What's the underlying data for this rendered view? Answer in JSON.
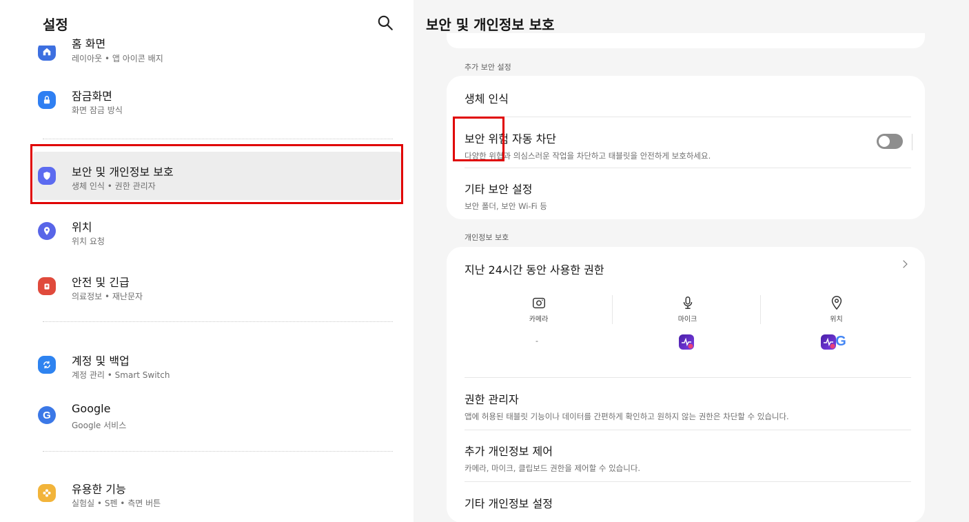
{
  "left": {
    "title": "설정",
    "partial_item_title": "홈 화면",
    "items": [
      {
        "icon": "home-icon",
        "color": "#3d6fe0",
        "title": "",
        "subtitle": "레이아웃 • 앱 아이콘 배지"
      },
      {
        "icon": "lock-icon",
        "color": "#2f7ff2",
        "title": "잠금화면",
        "subtitle": "화면 잠금 방식"
      },
      {
        "icon": "shield-icon",
        "color": "#5c6bf0",
        "title": "보안 및 개인정보 보호",
        "subtitle": "생체 인식 • 권한 관리자"
      },
      {
        "icon": "location-pin-icon",
        "color": "#5865e8",
        "title": "위치",
        "subtitle": "위치 요청"
      },
      {
        "icon": "emergency-icon",
        "color": "#e04a3c",
        "title": "안전 및 긴급",
        "subtitle": "의료정보 • 재난문자"
      },
      {
        "icon": "sync-icon",
        "color": "#2e83f0",
        "title": "계정 및 백업",
        "subtitle": "계정 관리 • Smart Switch"
      },
      {
        "icon": "google-g-icon",
        "color": "#3b78e7",
        "title": "Google",
        "subtitle": "Google 서비스"
      },
      {
        "icon": "flower-icon",
        "color": "#f2b43a",
        "title": "유용한 기능",
        "subtitle": "실험실 • S펜 • 측면 버튼"
      }
    ]
  },
  "right": {
    "title": "보안 및 개인정보 보호",
    "section_security": "추가 보안 설정",
    "biometrics": {
      "title": "생체 인식"
    },
    "auto_blocker": {
      "title": "보안 위험 자동 차단",
      "subtitle": "다양한 위협과 의심스러운 작업을 차단하고 태블릿을 안전하게 보호하세요.",
      "toggle_on": false
    },
    "other_security": {
      "title": "기타 보안 설정",
      "subtitle": "보안 폴더, 보안 Wi-Fi 등"
    },
    "section_privacy": "개인정보 보호",
    "perm_usage": {
      "title": "지난 24시간 동안 사용한 권한",
      "columns": [
        {
          "icon": "camera-icon",
          "label": "카메라",
          "apps": "-"
        },
        {
          "icon": "microphone-icon",
          "label": "마이크",
          "apps": ""
        },
        {
          "icon": "location-icon",
          "label": "위치",
          "apps": ""
        }
      ]
    },
    "perm_manager": {
      "title": "권한 관리자",
      "subtitle": "앱에 허용된 태블릿 기능이나 데이터를 간편하게 확인하고 원하지 않는 권한은 차단할 수 있습니다."
    },
    "extra_privacy": {
      "title": "추가 개인정보 제어",
      "subtitle": "카메라, 마이크, 클립보드 권한을 제어할 수 있습니다."
    },
    "other_privacy": {
      "title": "기타 개인정보 설정"
    }
  }
}
